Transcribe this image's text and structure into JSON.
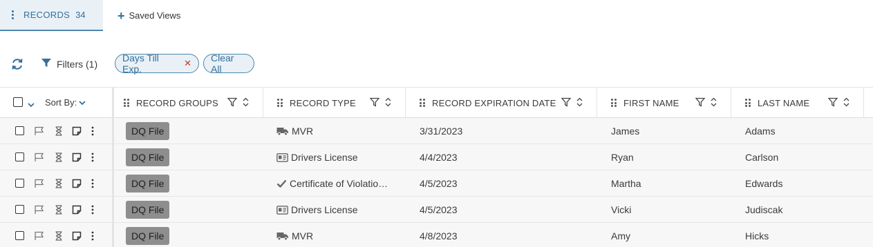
{
  "tabs": {
    "records_label": "RECORDS",
    "records_count": "34",
    "saved_views_label": "Saved Views"
  },
  "filterbar": {
    "filters_label": "Filters (1)",
    "chips": [
      "Days Till Exp.",
      "Clear All"
    ],
    "remove_glyph": "✕"
  },
  "table": {
    "sort_by_label": "Sort By:",
    "columns": [
      "RECORD GROUPS",
      "RECORD TYPE",
      "RECORD EXPIRATION DATE",
      "FIRST NAME",
      "LAST NAME"
    ],
    "rows": [
      {
        "group": "DQ File",
        "type": "MVR",
        "type_icon": "truck-icon",
        "date": "3/31/2023",
        "first": "James",
        "last": "Adams"
      },
      {
        "group": "DQ File",
        "type": "Drivers License",
        "type_icon": "id-card-icon",
        "date": "4/4/2023",
        "first": "Ryan",
        "last": "Carlson"
      },
      {
        "group": "DQ File",
        "type": "Certificate of Violatio…",
        "type_icon": "checkmark-icon",
        "date": "4/5/2023",
        "first": "Martha",
        "last": "Edwards"
      },
      {
        "group": "DQ File",
        "type": "Drivers License",
        "type_icon": "id-card-icon",
        "date": "4/5/2023",
        "first": "Vicki",
        "last": "Judiscak"
      },
      {
        "group": "DQ File",
        "type": "MVR",
        "type_icon": "truck-icon",
        "date": "4/8/2023",
        "first": "Amy",
        "last": "Hicks"
      }
    ]
  },
  "colors": {
    "accent": "#356f9b",
    "tab_bg": "#e9f1f7",
    "badge_bg": "#8e8e8e",
    "remove_red": "#d32f2f",
    "row_bg": "#f7f7f7"
  }
}
